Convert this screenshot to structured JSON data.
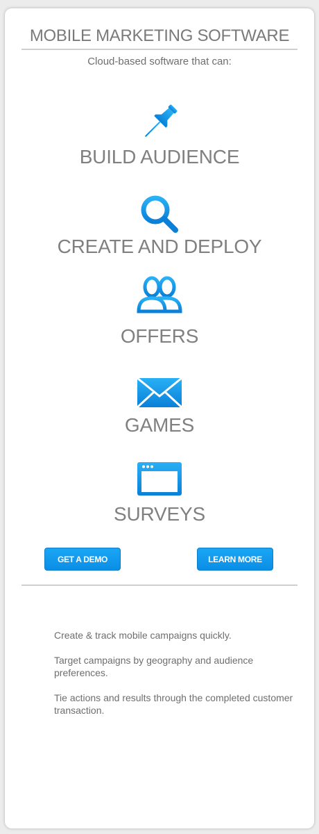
{
  "header": {
    "title": "MOBILE MARKETING SOFTWARE",
    "subtitle": "Cloud-based software that can:"
  },
  "features": [
    {
      "icon": "pushpin-icon",
      "label": "BUILD AUDIENCE"
    },
    {
      "icon": "magnifier-icon",
      "label": "CREATE AND DEPLOY"
    },
    {
      "icon": "users-icon",
      "label": "OFFERS"
    },
    {
      "icon": "envelope-icon",
      "label": "GAMES"
    },
    {
      "icon": "browser-window-icon",
      "label": "SURVEYS"
    }
  ],
  "buttons": {
    "demo_label": "GET A DEMO",
    "learn_label": "LEARN MORE"
  },
  "benefits": [
    "Create & track mobile campaigns quickly.",
    "Target campaigns by geography and audience preferences.",
    "Tie actions and results through the completed customer transaction."
  ],
  "colors": {
    "accent_blue": "#0a8ee6",
    "text_gray": "#808080",
    "background": "#ececec"
  }
}
